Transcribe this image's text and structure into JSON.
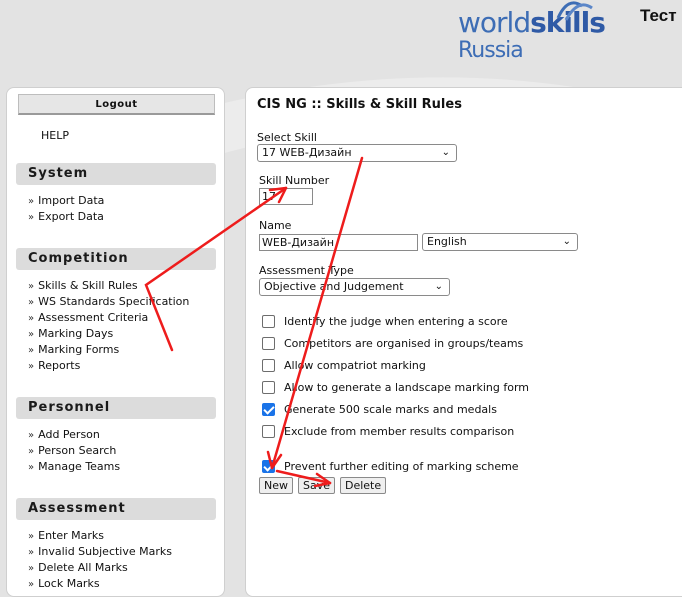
{
  "header": {
    "logo_world": "world",
    "logo_skills": "skills",
    "logo_russia": "Russia",
    "app_title": "Тест"
  },
  "sidebar": {
    "logout_label": "Logout",
    "help_label": "HELP",
    "sections": [
      {
        "title": "System",
        "items": [
          "Import Data",
          "Export Data"
        ]
      },
      {
        "title": "Competition",
        "items": [
          "Skills & Skill Rules",
          "WS Standards Specification",
          "Assessment Criteria",
          "Marking Days",
          "Marking Forms",
          "Reports"
        ]
      },
      {
        "title": "Personnel",
        "items": [
          "Add Person",
          "Person Search",
          "Manage Teams"
        ]
      },
      {
        "title": "Assessment",
        "items": [
          "Enter Marks",
          "Invalid Subjective Marks",
          "Delete All Marks",
          "Lock Marks"
        ]
      }
    ]
  },
  "main": {
    "title": "CIS NG :: Skills & Skill Rules",
    "select_skill_label": "Select Skill",
    "select_skill_value": "17 WEB-Дизайн",
    "skill_number_label": "Skill Number",
    "skill_number_value": "17",
    "name_label": "Name",
    "name_value": "WEB-Дизайн",
    "language_value": "English",
    "assessment_type_label": "Assessment Type",
    "assessment_type_value": "Objective and Judgement",
    "options": [
      {
        "label": "Identify the judge when entering a score",
        "checked": false
      },
      {
        "label": "Competitors are organised in groups/teams",
        "checked": false
      },
      {
        "label": "Allow compatriot marking",
        "checked": false
      },
      {
        "label": "Allow to generate a landscape marking form",
        "checked": false
      },
      {
        "label": "Generate 500 scale marks and medals",
        "checked": true
      },
      {
        "label": "Exclude from member results comparison",
        "checked": false
      }
    ],
    "lock_option": {
      "label": "Prevent further editing of marking scheme",
      "checked": true
    },
    "buttons": {
      "new": "New",
      "save": "Save",
      "delete": "Delete"
    }
  },
  "colors": {
    "annotation_arrow": "#ee1c1c",
    "brand_blue": "#3d6db5",
    "checkbox_accent": "#1a73e8"
  },
  "icons": {
    "caret": "chevron-down-icon",
    "bullet": "double-chevron-right-icon"
  }
}
